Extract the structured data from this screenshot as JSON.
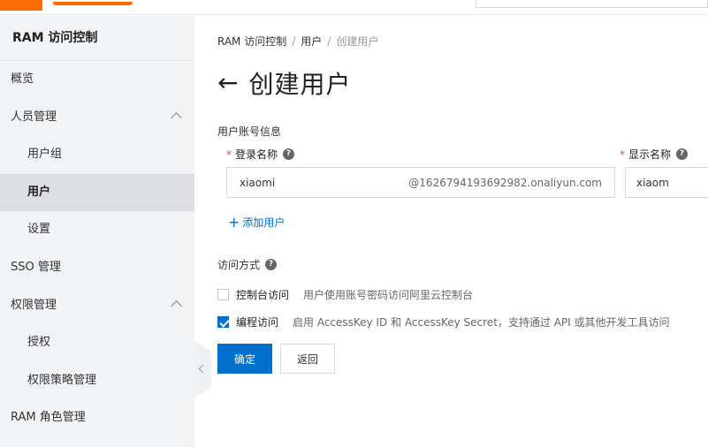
{
  "sidebar": {
    "title": "RAM 访问控制",
    "items": [
      {
        "label": "概览",
        "level": 1
      },
      {
        "label": "人员管理",
        "level": 1,
        "expanded": true
      },
      {
        "label": "用户组",
        "level": 2
      },
      {
        "label": "用户",
        "level": 2,
        "active": true
      },
      {
        "label": "设置",
        "level": 2
      },
      {
        "label": "SSO 管理",
        "level": 1
      },
      {
        "label": "权限管理",
        "level": 1,
        "expanded": true
      },
      {
        "label": "授权",
        "level": 2
      },
      {
        "label": "权限策略管理",
        "level": 2
      },
      {
        "label": "RAM 角色管理",
        "level": 1
      }
    ]
  },
  "breadcrumb": {
    "items": [
      "RAM 访问控制",
      "用户"
    ],
    "separator": "/",
    "current": "创建用户"
  },
  "page": {
    "back_icon": "←",
    "title": "创建用户"
  },
  "form": {
    "section_label": "用户账号信息",
    "login_name": {
      "label": "登录名称",
      "required_mark": "*",
      "value": "xiaomi",
      "suffix": "@1626794193692982.onaliyun.com"
    },
    "display_name": {
      "label": "显示名称",
      "required_mark": "*",
      "value": "xiaom"
    },
    "help_glyph": "?",
    "add_user": {
      "plus": "+",
      "label": "添加用户"
    },
    "access": {
      "label": "访问方式",
      "options": [
        {
          "name": "控制台访问",
          "description": "用户使用账号密码访问阿里云控制台",
          "checked": false
        },
        {
          "name": "编程访问",
          "description": "启用 AccessKey ID 和 AccessKey Secret，支持通过 API 或其他开发工具访问",
          "checked": true
        }
      ]
    },
    "buttons": {
      "confirm": "确定",
      "back": "返回"
    }
  },
  "colors": {
    "brand_orange": "#ff6a00",
    "primary_blue": "#0070cc",
    "required_red": "#e24c36",
    "sidebar_bg": "#f2f3f5",
    "sidebar_active_bg": "#dcdee2"
  }
}
